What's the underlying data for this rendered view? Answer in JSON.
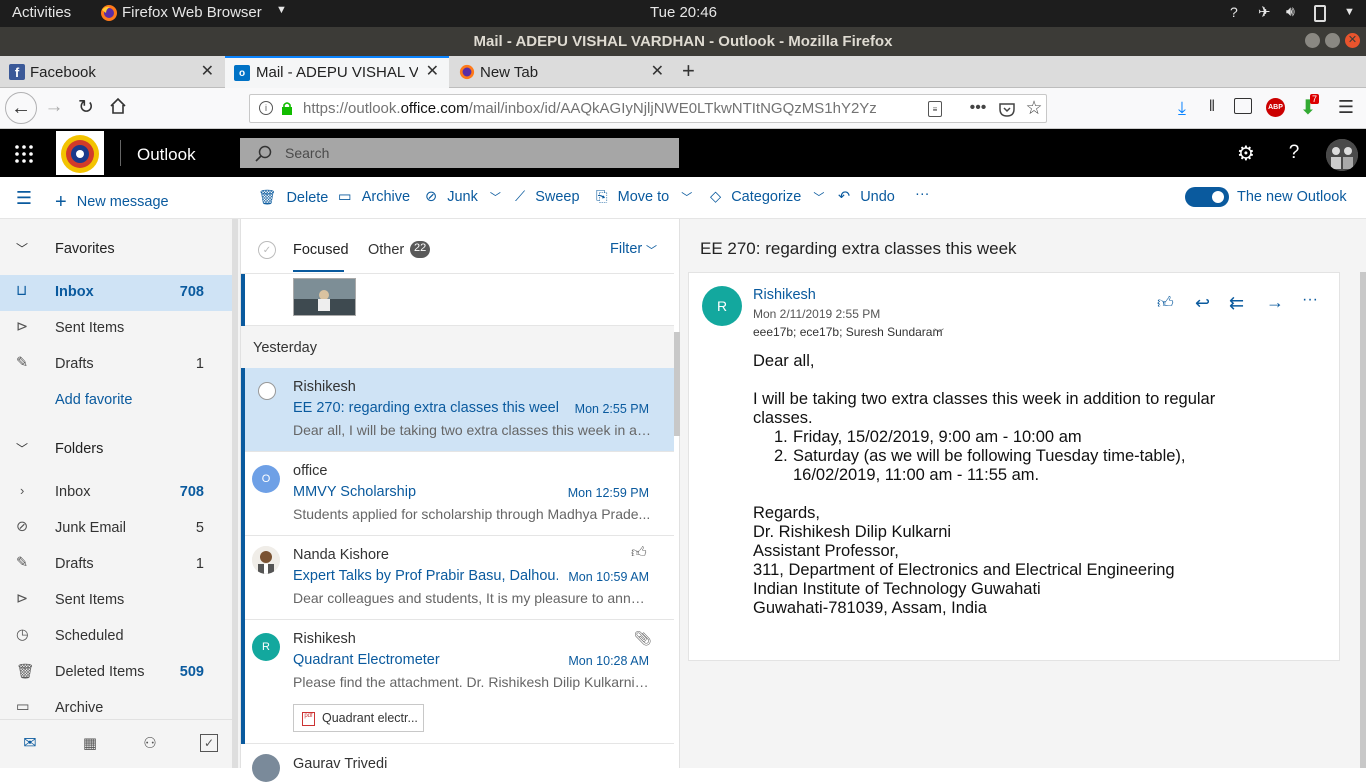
{
  "system": {
    "activities": "Activities",
    "app_name": "Firefox Web Browser",
    "clock": "Tue 20:46"
  },
  "window": {
    "title": "Mail - ADEPU VISHAL VARDHAN - Outlook - Mozilla Firefox"
  },
  "tabs": [
    {
      "label": "Facebook"
    },
    {
      "label": "Mail - ADEPU VISHAL VARDHAN"
    },
    {
      "label": "New Tab"
    }
  ],
  "browser": {
    "url_prefix": "https://outlook.",
    "url_domain": "office.com",
    "url_rest": "/mail/inbox/id/AAQkAGIyNjljNWE0LTkwNTItNGQzMS1hY2Yz",
    "notif_badge": "7"
  },
  "outlook": {
    "brand": "Outlook",
    "search_placeholder": "Search",
    "commands": {
      "new_message": "New message",
      "delete": "Delete",
      "archive": "Archive",
      "junk": "Junk",
      "sweep": "Sweep",
      "move_to": "Move to",
      "categorize": "Categorize",
      "undo": "Undo",
      "more": "···",
      "new_outlook": "The new Outlook"
    },
    "favorites": {
      "header": "Favorites",
      "items": [
        {
          "label": "Inbox",
          "count": "708"
        },
        {
          "label": "Sent Items",
          "count": ""
        },
        {
          "label": "Drafts",
          "count": "1"
        }
      ],
      "add": "Add favorite"
    },
    "folders": {
      "header": "Folders",
      "items": [
        {
          "label": "Inbox",
          "count": "708"
        },
        {
          "label": "Junk Email",
          "count": "5"
        },
        {
          "label": "Drafts",
          "count": "1"
        },
        {
          "label": "Sent Items",
          "count": ""
        },
        {
          "label": "Scheduled",
          "count": ""
        },
        {
          "label": "Deleted Items",
          "count": "509"
        },
        {
          "label": "Archive",
          "count": ""
        }
      ]
    },
    "list": {
      "focused": "Focused",
      "other": "Other",
      "other_count": "22",
      "filter": "Filter",
      "group_yesterday": "Yesterday",
      "messages": [
        {
          "from": "Rishikesh",
          "subject": "EE 270: regarding extra classes this week",
          "time": "Mon 2:55 PM",
          "preview": "Dear all, I will be taking two extra classes this week in ad...",
          "avatar": "R"
        },
        {
          "from": "office",
          "subject": "MMVY Scholarship",
          "time": "Mon 12:59 PM",
          "preview": "Students applied for scholarship through Madhya Prade...",
          "avatar": "O"
        },
        {
          "from": "Nanda Kishore",
          "subject": "Expert Talks by Prof Prabir Basu, Dalhou...",
          "time": "Mon 10:59 AM",
          "preview": "Dear colleagues and students, It is my pleasure to annou..."
        },
        {
          "from": "Rishikesh",
          "subject": "Quadrant Electrometer",
          "time": "Mon 10:28 AM",
          "preview": "Please find the attachment. Dr. Rishikesh Dilip Kulkarni A...",
          "avatar": "R",
          "attachment": "Quadrant electr..."
        },
        {
          "from": "Gaurav Trivedi"
        }
      ]
    },
    "reading": {
      "subject": "EE 270: regarding extra classes this week",
      "sender": "Rishikesh",
      "avatar": "R",
      "date": "Mon 2/11/2019 2:55 PM",
      "recipients": "eee17b; ece17b; Suresh Sundaram",
      "body": {
        "greeting": "Dear all,",
        "line1": "I will be taking two extra classes this week in addition to regular",
        "line2": "classes.",
        "item1": "Friday, 15/02/2019, 9:00 am - 10:00 am",
        "item2a": "Saturday (as we will be following Tuesday time-table),",
        "item2b": "16/02/2019, 11:00 am - 11:55 am.",
        "regards": "Regards,",
        "sig1": "Dr. Rishikesh Dilip Kulkarni",
        "sig2": "Assistant Professor,",
        "sig3": "311, Department of Electronics and Electrical Engineering",
        "sig4": "Indian Institute of Technology Guwahati",
        "sig5": "Guwahati-781039, Assam, India"
      }
    }
  }
}
